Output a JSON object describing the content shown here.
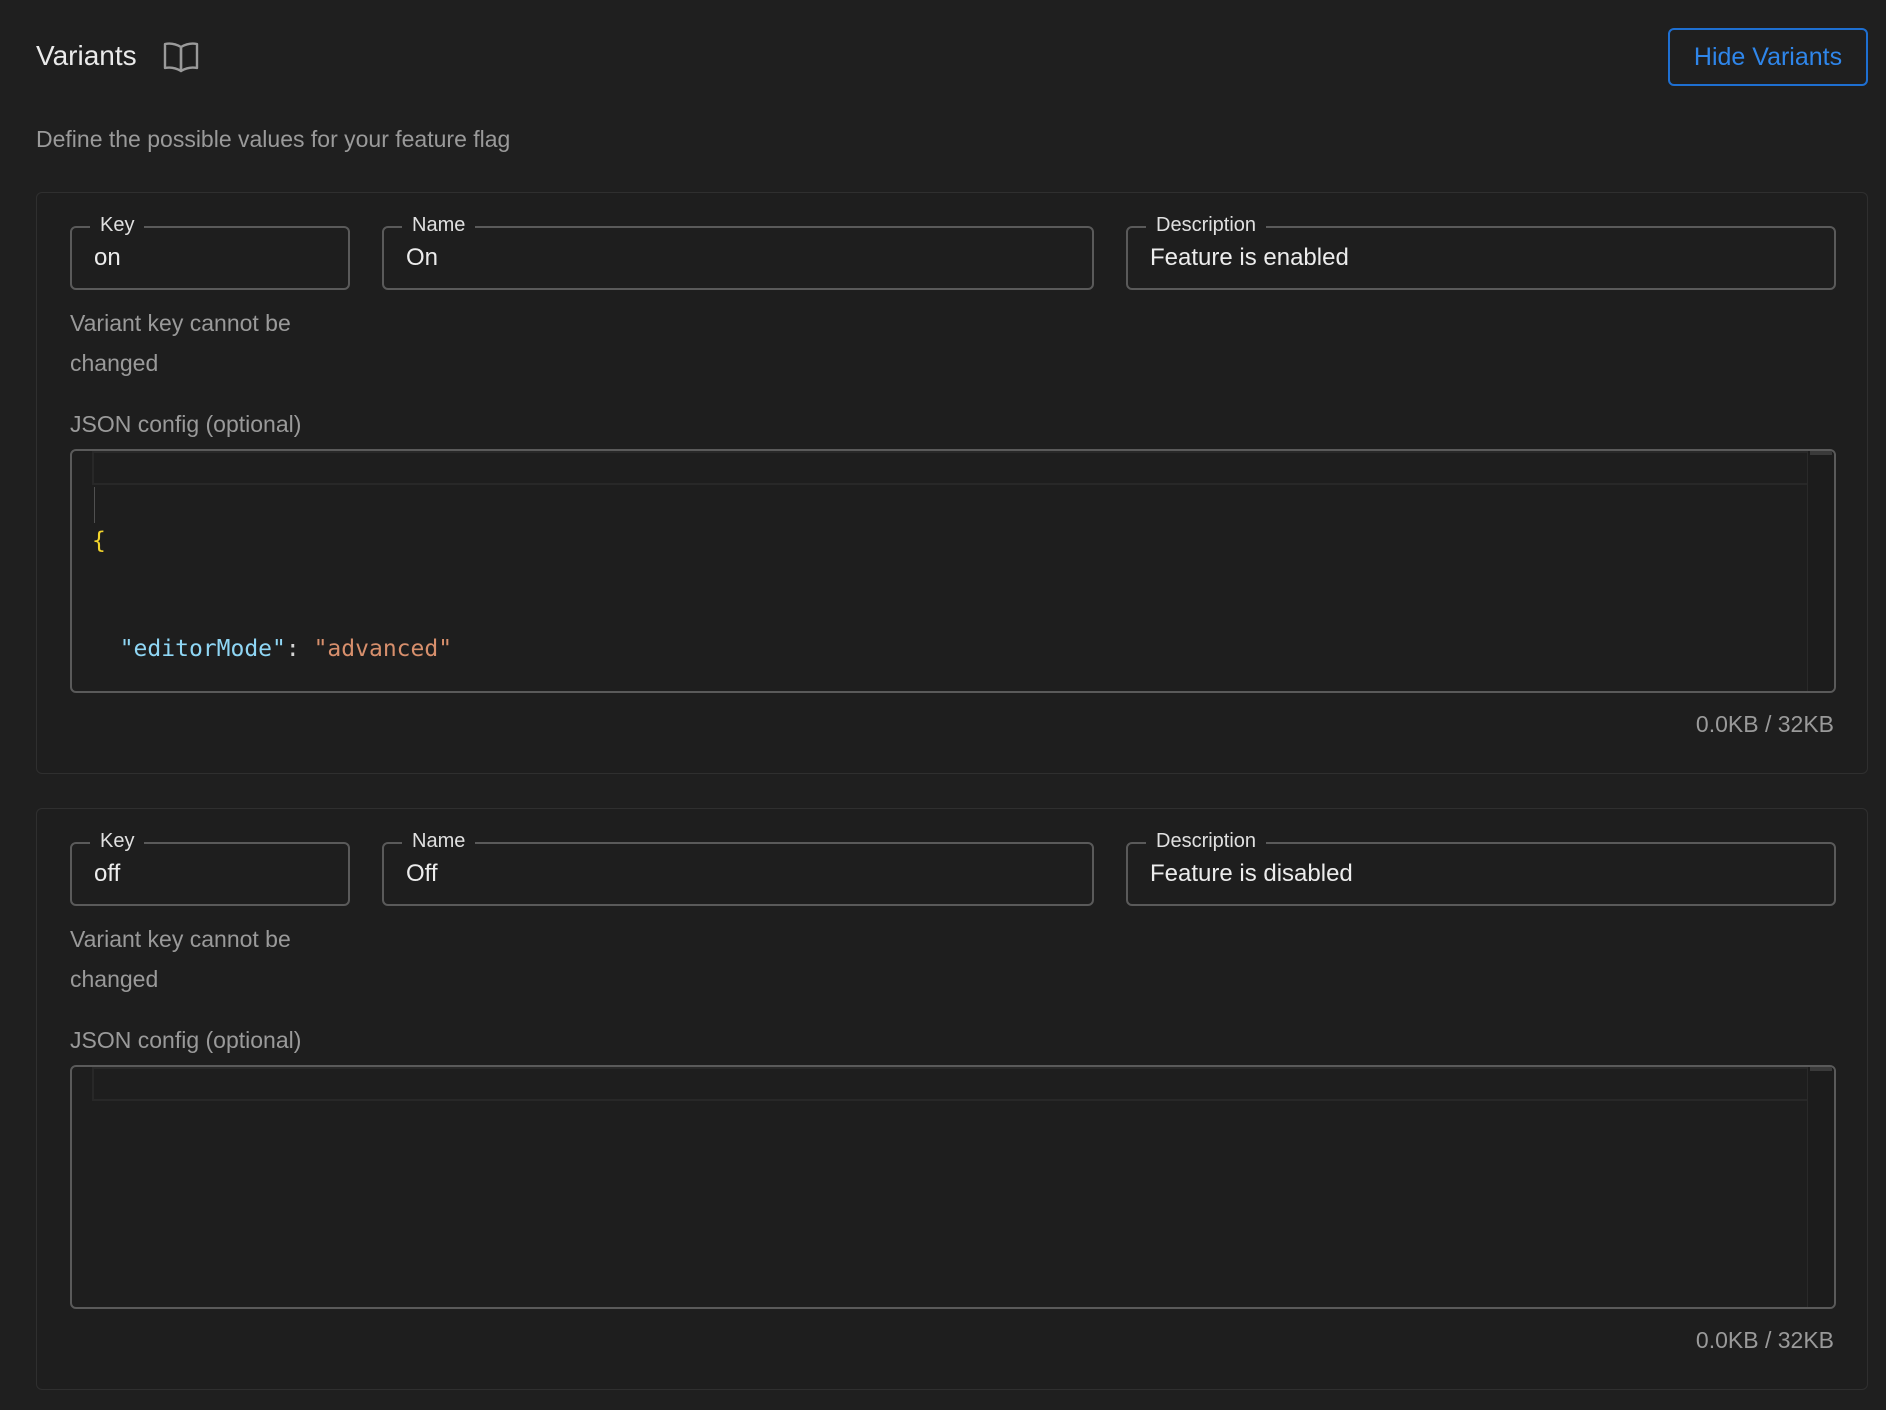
{
  "header": {
    "title": "Variants",
    "hide_button_label": "Hide Variants",
    "subtitle": "Define the possible values for your feature flag"
  },
  "labels": {
    "key": "Key",
    "name": "Name",
    "description": "Description",
    "json_config": "JSON config (optional)",
    "key_helper": "Variant key cannot be changed"
  },
  "variants": [
    {
      "key": "on",
      "name": "On",
      "description": "Feature is enabled",
      "json_lines": {
        "open": "{",
        "key": "\"editorMode\"",
        "colon": ": ",
        "value": "\"advanced\"",
        "close": "}"
      },
      "size": "0.0KB / 32KB"
    },
    {
      "key": "off",
      "name": "Off",
      "description": "Feature is disabled",
      "size": "0.0KB / 32KB"
    }
  ],
  "colors": {
    "accent": "#2f86ea",
    "background": "#1f1f1f",
    "json_brace": "#f2d42c",
    "json_key": "#8fd6f4",
    "json_string": "#d78f6c"
  },
  "icons": {
    "docs": "book-icon"
  }
}
